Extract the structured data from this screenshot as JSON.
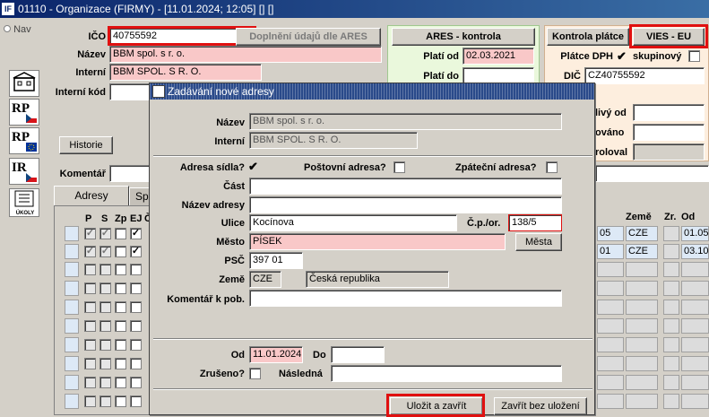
{
  "window": {
    "title": "01110 - Organizace (FIRMY) - [11.01.2024; 12:05] [] []",
    "app_icon": "IF"
  },
  "nav": {
    "label": "Nav"
  },
  "side_icons": [
    {
      "name": "building-icon",
      "text": ""
    },
    {
      "name": "rp-cz-icon",
      "text": "RP"
    },
    {
      "name": "rp-eu-icon",
      "text": "RP"
    },
    {
      "name": "ir-cz-icon",
      "text": "IR"
    },
    {
      "name": "tasks-icon",
      "text": "ÚKOLY"
    }
  ],
  "main": {
    "ico_label": "IČO",
    "ico_value": "40755592",
    "doplneni_button": "Doplnění údajů dle ARES",
    "nazev_label": "Název",
    "nazev_value": "BBM spol. s r. o.",
    "interni_label": "Interní",
    "interni_value": "BBM SPOL. S R. O.",
    "interni_kod_label": "Interní kód",
    "interni_kod_value": "",
    "historie_button": "Historie",
    "komentar_label": "Komentář",
    "tab_adresy": "Adresy",
    "tab_sp": "Sp"
  },
  "ares": {
    "header": "ARES - kontrola",
    "plati_od_label": "Platí od",
    "plati_od_value": "02.03.2021",
    "plati_do_label": "Platí do"
  },
  "vat": {
    "kontrola_button": "Kontrola plátce",
    "vies_button": "VIES - EU",
    "platce_label": "Plátce DPH",
    "platce_checked": "✔",
    "skupinovy_label": "skupinový",
    "dic_label": "DIČ",
    "dic_value": "CZ40755592",
    "spolehlivy_label": "livý od",
    "overovano_label": "ováno",
    "kontroloval_label": "roloval"
  },
  "grid": {
    "headers": [
      "P",
      "S",
      "Zp",
      "EJ",
      "Č"
    ],
    "right_headers": {
      "zeme": "Země",
      "zr": "Zr.",
      "od": "Od"
    },
    "rows": [
      {
        "col1": "05",
        "zeme": "CZE",
        "od": "01.05"
      },
      {
        "col1": "01",
        "zeme": "CZE",
        "od": "03.10"
      }
    ]
  },
  "dialog": {
    "title": "Zadávání nové adresy",
    "nazev_label": "Název",
    "nazev_value": "BBM spol. s r. o.",
    "interni_label": "Interní",
    "interni_value": "BBM SPOL. S R. O.",
    "adresa_sidla_label": "Adresa sídla?",
    "adresa_sidla_checked": "✔",
    "postovni_label": "Poštovní adresa?",
    "zpatecni_label": "Zpáteční adresa?",
    "cast_label": "Část",
    "cast_value": "",
    "nazev_adresy_label": "Název adresy",
    "nazev_adresy_value": "",
    "ulice_label": "Ulice",
    "ulice_value": "Kocínova",
    "cp_label": "Č.p./or.",
    "cp_value": "138/5",
    "mesto_label": "Město",
    "mesto_value": "PÍSEK",
    "mesta_button": "Města",
    "psc_label": "PSČ",
    "psc_value": "397 01",
    "zeme_label": "Země",
    "zeme_code": "CZE",
    "zeme_name": "Česká republika",
    "komentar_label": "Komentář k pob.",
    "komentar_value": "",
    "od_label": "Od",
    "od_value": "11.01.2024",
    "do_label": "Do",
    "do_value": "",
    "zruseno_label": "Zrušeno?",
    "nasledna_label": "Následná",
    "nasledna_value": "",
    "save_button": "Uložit a zavřít",
    "close_button": "Zavřít bez uložení"
  },
  "colors": {
    "required_field": "#f9c8c8",
    "highlight_box": "#e01010",
    "title_bar": "#0a246a"
  }
}
